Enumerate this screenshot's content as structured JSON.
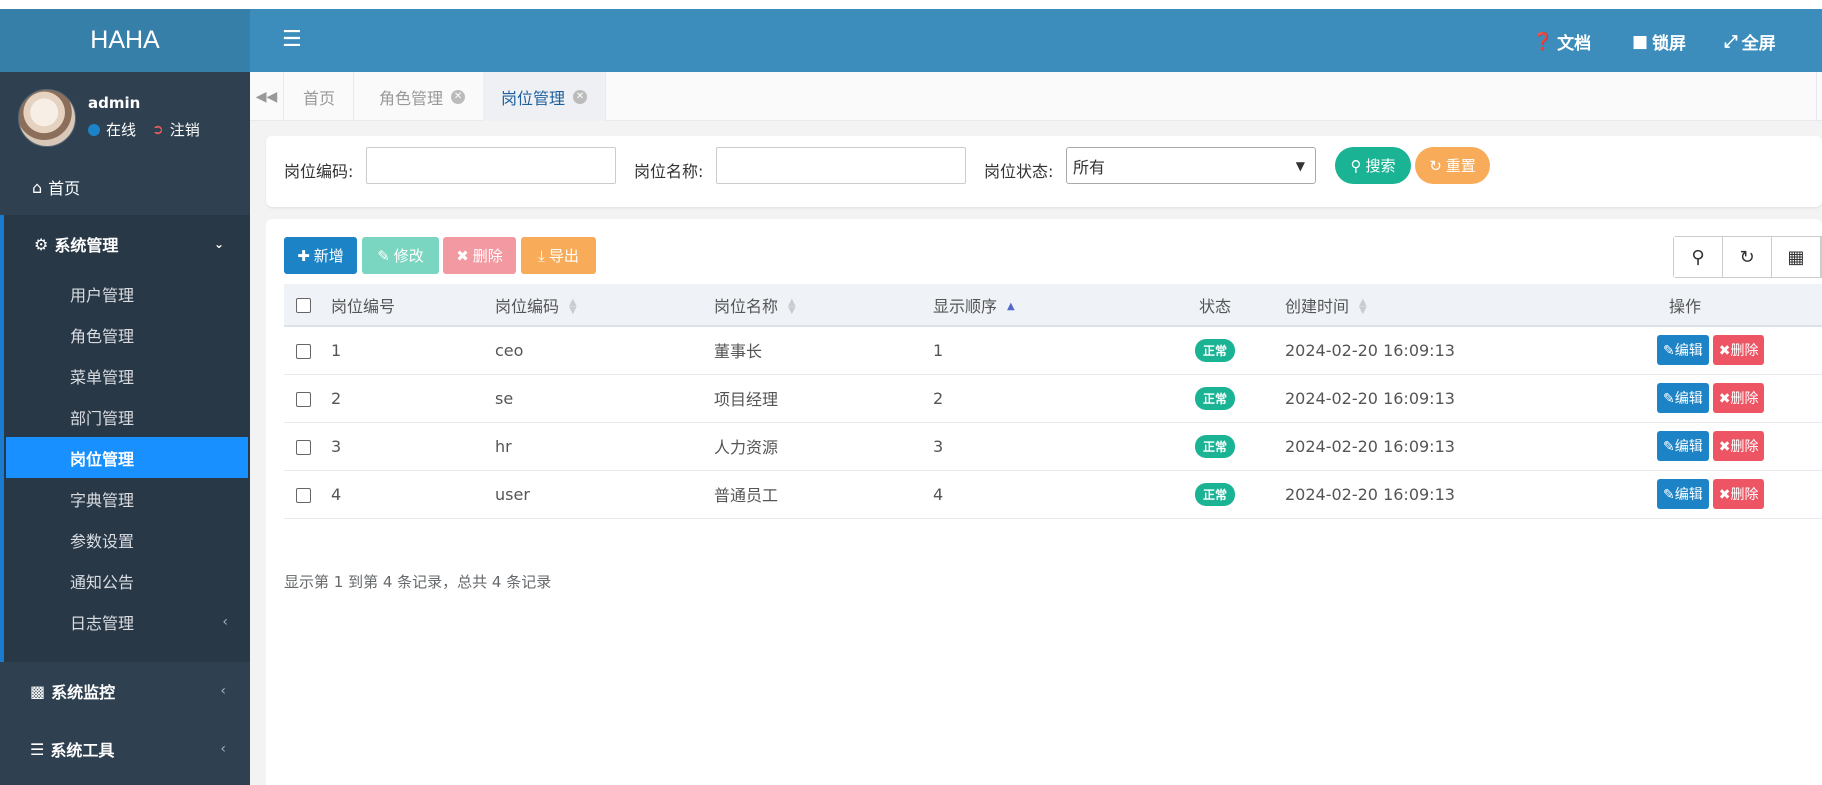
{
  "app": {
    "brand": "HAHA"
  },
  "user": {
    "name": "admin",
    "online": "在线",
    "logout": "注销"
  },
  "sidebar": {
    "home": "首页",
    "group": {
      "label": "系统管理",
      "items": [
        "用户管理",
        "角色管理",
        "菜单管理",
        "部门管理",
        "岗位管理",
        "字典管理",
        "参数设置",
        "通知公告",
        "日志管理"
      ]
    },
    "monitor": "系统监控",
    "tools": "系统工具"
  },
  "header": {
    "docs": "文档",
    "lock": "锁屏",
    "fullscreen": "全屏"
  },
  "tabs": [
    "首页",
    "角色管理",
    "岗位管理"
  ],
  "search": {
    "code_label": "岗位编码:",
    "name_label": "岗位名称:",
    "status_label": "岗位状态:",
    "status_value": "所有",
    "search_btn": "搜索",
    "reset_btn": "重置"
  },
  "toolbar": {
    "add": "新增",
    "edit": "修改",
    "delete": "删除",
    "export": "导出"
  },
  "table": {
    "headers": [
      "岗位编号",
      "岗位编码",
      "岗位名称",
      "显示顺序",
      "状态",
      "创建时间",
      "操作"
    ],
    "rows": [
      {
        "id": "1",
        "code": "ceo",
        "name": "董事长",
        "order": "1",
        "status": "正常",
        "time": "2024-02-20 16:09:13"
      },
      {
        "id": "2",
        "code": "se",
        "name": "项目经理",
        "order": "2",
        "status": "正常",
        "time": "2024-02-20 16:09:13"
      },
      {
        "id": "3",
        "code": "hr",
        "name": "人力资源",
        "order": "3",
        "status": "正常",
        "time": "2024-02-20 16:09:13"
      },
      {
        "id": "4",
        "code": "user",
        "name": "普通员工",
        "order": "4",
        "status": "正常",
        "time": "2024-02-20 16:09:13"
      }
    ],
    "edit_label": "编辑",
    "delete_label": "删除"
  },
  "pager": "显示第 1 到第 4 条记录，总共 4 条记录"
}
